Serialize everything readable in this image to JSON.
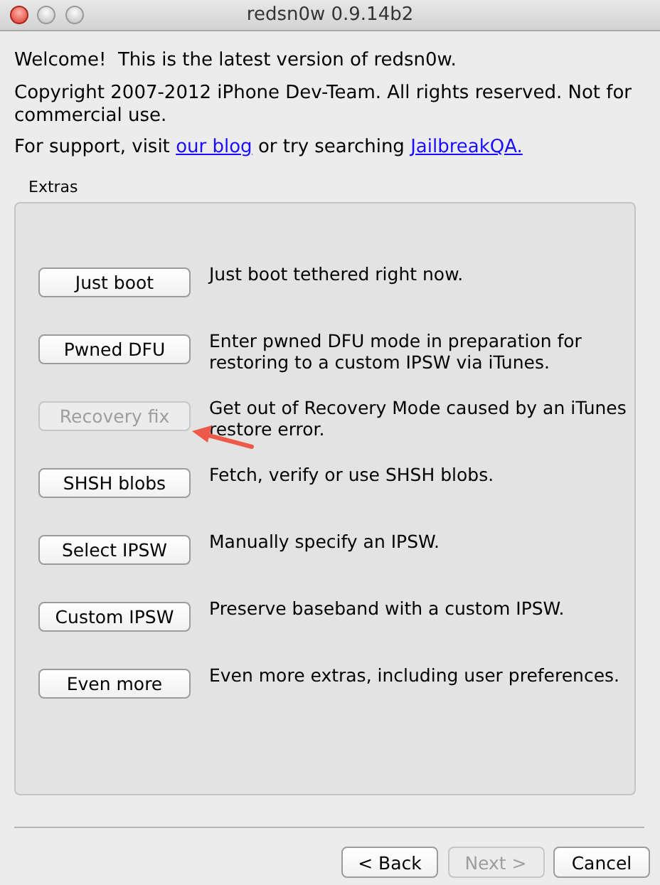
{
  "window": {
    "title": "redsn0w 0.9.14b2"
  },
  "intro": [
    {
      "kind": "text",
      "text": "Welcome!  This is the latest version of redsn0w."
    },
    {
      "kind": "text",
      "text": "Copyright 2007-2012 iPhone Dev-Team. All rights reserved. Not for commercial use."
    }
  ],
  "support": [
    {
      "kind": "text",
      "text": "For support, visit"
    },
    {
      "kind": "link",
      "text": "our blog"
    },
    {
      "kind": "text",
      "text": "or try searching"
    },
    {
      "kind": "link",
      "text": "JailbreakQA."
    }
  ],
  "extras": {
    "title": "Extras",
    "items": [
      {
        "label": "Just boot",
        "description": "Just boot tethered right now.",
        "disabled": false
      },
      {
        "label": "Pwned DFU",
        "description": "Enter pwned DFU mode in preparation for restoring to a custom IPSW via iTunes.",
        "disabled": false
      },
      {
        "label": "Recovery fix",
        "description": "Get out of Recovery Mode caused by an iTunes restore error.",
        "disabled": true
      },
      {
        "label": "SHSH blobs",
        "description": "Fetch, verify or use SHSH blobs.",
        "disabled": false
      },
      {
        "label": "Select IPSW",
        "description": "Manually specify an IPSW.",
        "disabled": false
      },
      {
        "label": "Custom IPSW",
        "description": "Preserve baseband with a custom IPSW.",
        "disabled": false
      },
      {
        "label": "Even more",
        "description": "Even more extras, including user preferences.",
        "disabled": false
      }
    ]
  },
  "nav_buttons": [
    {
      "label": "< Back",
      "disabled": false
    },
    {
      "label": "Next >",
      "disabled": true
    },
    {
      "label": "Cancel",
      "disabled": false
    }
  ]
}
